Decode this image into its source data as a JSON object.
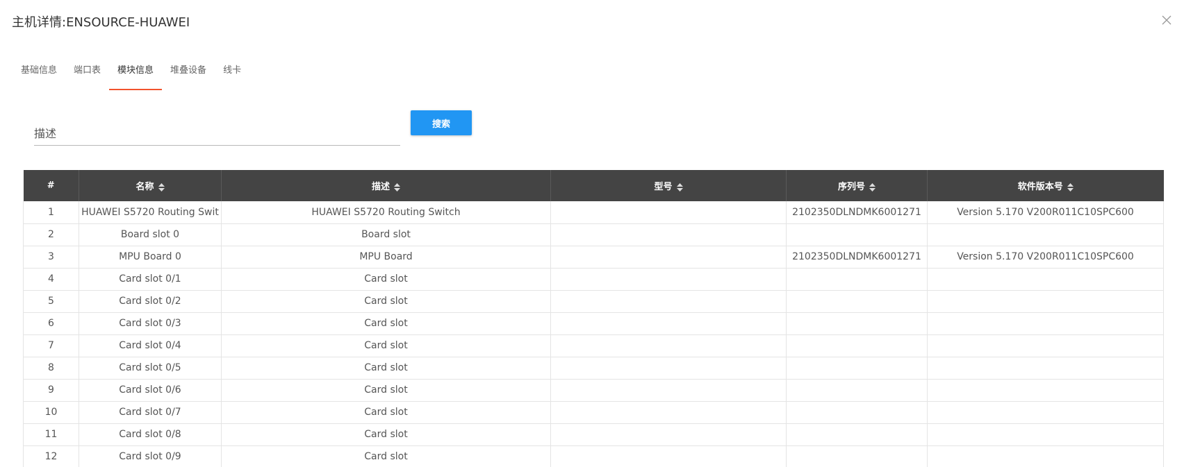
{
  "dialog": {
    "title": "主机详情:ENSOURCE-HUAWEI"
  },
  "tabs": [
    {
      "label": "基础信息",
      "active": false
    },
    {
      "label": "端口表",
      "active": false
    },
    {
      "label": "模块信息",
      "active": true
    },
    {
      "label": "堆叠设备",
      "active": false
    },
    {
      "label": "线卡",
      "active": false
    }
  ],
  "search": {
    "placeholder": "描述",
    "value": "",
    "button_label": "搜索"
  },
  "table": {
    "columns": [
      "#",
      "名称",
      "描述",
      "型号",
      "序列号",
      "软件版本号"
    ],
    "rows": [
      [
        "1",
        "HUAWEI S5720 Routing Swit",
        "HUAWEI S5720 Routing Switch",
        "",
        "2102350DLNDMK6001271",
        "Version 5.170 V200R011C10SPC600"
      ],
      [
        "2",
        "Board slot 0",
        "Board slot",
        "",
        "",
        ""
      ],
      [
        "3",
        "MPU Board 0",
        "MPU Board",
        "",
        "2102350DLNDMK6001271",
        "Version 5.170 V200R011C10SPC600"
      ],
      [
        "4",
        "Card slot 0/1",
        "Card slot",
        "",
        "",
        ""
      ],
      [
        "5",
        "Card slot 0/2",
        "Card slot",
        "",
        "",
        ""
      ],
      [
        "6",
        "Card slot 0/3",
        "Card slot",
        "",
        "",
        ""
      ],
      [
        "7",
        "Card slot 0/4",
        "Card slot",
        "",
        "",
        ""
      ],
      [
        "8",
        "Card slot 0/5",
        "Card slot",
        "",
        "",
        ""
      ],
      [
        "9",
        "Card slot 0/6",
        "Card slot",
        "",
        "",
        ""
      ],
      [
        "10",
        "Card slot 0/7",
        "Card slot",
        "",
        "",
        ""
      ],
      [
        "11",
        "Card slot 0/8",
        "Card slot",
        "",
        "",
        ""
      ],
      [
        "12",
        "Card slot 0/9",
        "Card slot",
        "",
        "",
        ""
      ]
    ]
  },
  "icons": {
    "close": "close-icon",
    "sort": "sort-icon"
  },
  "colors": {
    "accent": "#f2532c",
    "primary_button": "#2196f3",
    "header_bg": "#444444"
  }
}
